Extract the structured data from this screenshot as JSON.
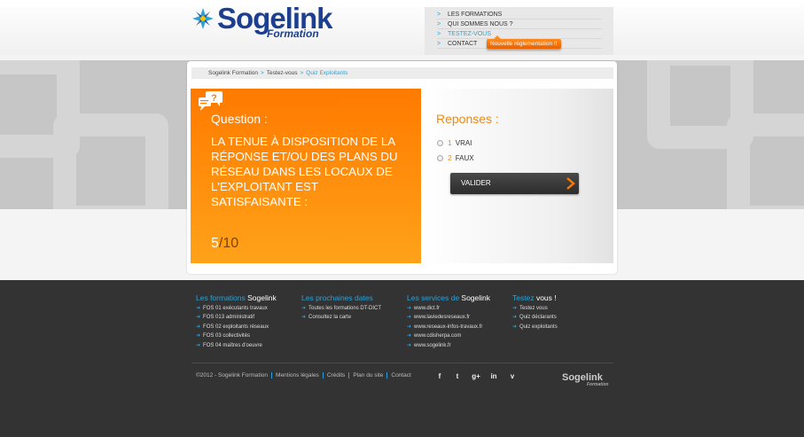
{
  "header": {
    "logo_name": "Sogelink",
    "logo_sub": "Formation",
    "nav": [
      {
        "label": "LES FORMATIONS",
        "active": false
      },
      {
        "label": "QUI SOMMES NOUS ?",
        "active": false
      },
      {
        "label": "TESTEZ-VOUS",
        "active": true
      },
      {
        "label": "CONTACT",
        "active": false
      }
    ],
    "nav_arrow": ">",
    "tooltip": "Nouvelle réglementation !!"
  },
  "breadcrumb": {
    "items": [
      "Sogelink Formation",
      "Testez-vous",
      "Quiz Exploitants"
    ],
    "separator": ">"
  },
  "question": {
    "label": "Question :",
    "text": "LA TENUE À DISPOSITION DE LA RÉPONSE ET/OU DES PLANS DU RÉSEAU DANS LES LOCAUX DE L'EXPLOITANT EST SATISFAISANTE :",
    "current": "5",
    "total": "/10",
    "icon": "speech-bubble-question-icon"
  },
  "answers": {
    "label": "Reponses :",
    "options": [
      {
        "num": "1",
        "text": "VRAI"
      },
      {
        "num": "2",
        "text": "FAUX"
      }
    ],
    "validate_label": "VALIDER"
  },
  "footer": {
    "columns": [
      {
        "title_hl": "Les formations",
        "title_rest": " Sogelink",
        "items": [
          "FOS 01 exécutants travaux",
          "FOS 013 administratif",
          "FOS 02 exploitants réseaux",
          "FOS 03 collectivités",
          "FOS 04 maîtres d'oeuvre"
        ]
      },
      {
        "title_hl": "Les prochaines dates",
        "title_rest": "",
        "items": [
          "Toutes les formations DT-DICT",
          "Consultez la carte"
        ]
      },
      {
        "title_hl": "Les services de",
        "title_rest": " Sogelink",
        "items": [
          "www.dict.fr",
          "www.laviedesreseaux.fr",
          "www.reseaux-infos-travaux.fr",
          "www.cdisherpa.com",
          "www.sogelink.fr"
        ]
      },
      {
        "title_hl": "Testez",
        "title_rest": " vous !",
        "items": [
          "Testez vous",
          "Quiz déclarants",
          "Quiz exploitants"
        ]
      }
    ],
    "item_arrow": "➜",
    "bottom_links": [
      "©2012 - Sogelink Formation",
      "Mentions légales",
      "Crédits",
      "Plan du site",
      "Contact"
    ],
    "social": [
      {
        "name": "facebook-icon",
        "glyph": "f"
      },
      {
        "name": "twitter-icon",
        "glyph": "t"
      },
      {
        "name": "google-plus-icon",
        "glyph": "g+"
      },
      {
        "name": "linkedin-icon",
        "glyph": "in"
      },
      {
        "name": "viadeo-icon",
        "glyph": "v"
      }
    ],
    "logo": "Sogelink",
    "logo_sub": "Formation"
  },
  "colors": {
    "brand_blue": "#1c3f8f",
    "accent_blue": "#2aa2d9",
    "orange": "#ff7a00"
  }
}
